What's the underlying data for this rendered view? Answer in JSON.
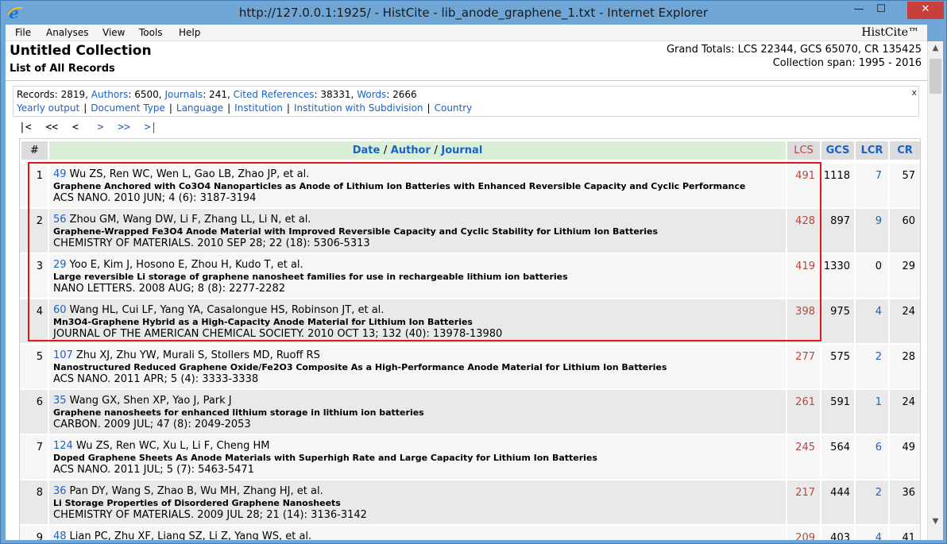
{
  "window": {
    "title": "http://127.0.0.1:1925/ - HistCite - lib_anode_graphene_1.txt - Internet Explorer",
    "minimize_glyph": "—",
    "maximize_glyph": "☐",
    "close_glyph": "✕"
  },
  "menu": {
    "items": [
      "File",
      "Analyses",
      "View",
      "Tools",
      "Help"
    ],
    "brand": "HistCite™"
  },
  "header": {
    "title": "Untitled Collection",
    "subtitle": "List of All Records",
    "grand_totals": "Grand Totals: LCS 22344, GCS 65070, CR 135425",
    "collection_span": "Collection span: 1995 - 2016"
  },
  "summary": {
    "records_label": "Records",
    "records_value": ": 2819, ",
    "authors_label": "Authors",
    "authors_value": ": 6500, ",
    "journals_label": "Journals",
    "journals_value": ": 241, ",
    "cited_label": "Cited References",
    "cited_value": ": 38331, ",
    "words_label": "Words",
    "words_value": ": 2666",
    "close": "x",
    "links": [
      "Yearly output",
      "Document Type",
      "Language",
      "Institution",
      "Institution with Subdivision",
      "Country"
    ],
    "separator": "|"
  },
  "pager": {
    "first": "|<",
    "prev_many": "<<",
    "prev": "<",
    "next": ">",
    "next_many": ">>",
    "last": ">|"
  },
  "table": {
    "col_num": "#",
    "col_date": "Date",
    "col_author": "Author",
    "col_journal": "Journal",
    "col_slash": "/",
    "col_lcs": "LCS",
    "col_gcs": "GCS",
    "col_lcr": "LCR",
    "col_cr": "CR",
    "rows": [
      {
        "num": "1",
        "rid": "49",
        "authors": "Wu ZS, Ren WC, Wen L, Gao LB, Zhao JP, et al.",
        "title": "Graphene Anchored with Co3O4 Nanoparticles as Anode of Lithium Ion Batteries with Enhanced Reversible Capacity and Cyclic Performance",
        "source": "ACS NANO. 2010 JUN; 4 (6): 3187-3194",
        "lcs": "491",
        "gcs": "1118",
        "lcr": "7",
        "cr": "57"
      },
      {
        "num": "2",
        "rid": "56",
        "authors": "Zhou GM, Wang DW, Li F, Zhang LL, Li N, et al.",
        "title": "Graphene-Wrapped Fe3O4 Anode Material with Improved Reversible Capacity and Cyclic Stability for Lithium Ion Batteries",
        "source": "CHEMISTRY OF MATERIALS. 2010 SEP 28; 22 (18): 5306-5313",
        "lcs": "428",
        "gcs": "897",
        "lcr": "9",
        "cr": "60"
      },
      {
        "num": "3",
        "rid": "29",
        "authors": "Yoo E, Kim J, Hosono E, Zhou H, Kudo T, et al.",
        "title": "Large reversible Li storage of graphene nanosheet families for use in rechargeable lithium ion batteries",
        "source": "NANO LETTERS. 2008 AUG; 8 (8): 2277-2282",
        "lcs": "419",
        "gcs": "1330",
        "lcr": "0",
        "cr": "29"
      },
      {
        "num": "4",
        "rid": "60",
        "authors": "Wang HL, Cui LF, Yang YA, Casalongue HS, Robinson JT, et al.",
        "title": "Mn3O4-Graphene Hybrid as a High-Capacity Anode Material for Lithium Ion Batteries",
        "source": "JOURNAL OF THE AMERICAN CHEMICAL SOCIETY. 2010 OCT 13; 132 (40): 13978-13980",
        "lcs": "398",
        "gcs": "975",
        "lcr": "4",
        "cr": "24"
      },
      {
        "num": "5",
        "rid": "107",
        "authors": "Zhu XJ, Zhu YW, Murali S, Stollers MD, Ruoff RS",
        "title": "Nanostructured Reduced Graphene Oxide/Fe2O3 Composite As a High-Performance Anode Material for Lithium Ion Batteries",
        "source": "ACS NANO. 2011 APR; 5 (4): 3333-3338",
        "lcs": "277",
        "gcs": "575",
        "lcr": "2",
        "cr": "28"
      },
      {
        "num": "6",
        "rid": "35",
        "authors": "Wang GX, Shen XP, Yao J, Park J",
        "title": "Graphene nanosheets for enhanced lithium storage in lithium ion batteries",
        "source": "CARBON. 2009 JUL; 47 (8): 2049-2053",
        "lcs": "261",
        "gcs": "591",
        "lcr": "1",
        "cr": "24"
      },
      {
        "num": "7",
        "rid": "124",
        "authors": "Wu ZS, Ren WC, Xu L, Li F, Cheng HM",
        "title": "Doped Graphene Sheets As Anode Materials with Superhigh Rate and Large Capacity for Lithium Ion Batteries",
        "source": "ACS NANO. 2011 JUL; 5 (7): 5463-5471",
        "lcs": "245",
        "gcs": "564",
        "lcr": "6",
        "cr": "49"
      },
      {
        "num": "8",
        "rid": "36",
        "authors": "Pan DY, Wang S, Zhao B, Wu MH, Zhang HJ, et al.",
        "title": "Li Storage Properties of Disordered Graphene Nanosheets",
        "source": "CHEMISTRY OF MATERIALS. 2009 JUL 28; 21 (14): 3136-3142",
        "lcs": "217",
        "gcs": "444",
        "lcr": "2",
        "cr": "36"
      },
      {
        "num": "9",
        "rid": "48",
        "authors": "Lian PC, Zhu XF, Liang SZ, Li Z, Yang WS, et al.",
        "title": "",
        "source": "",
        "lcs": "209",
        "gcs": "403",
        "lcr": "4",
        "cr": "41"
      }
    ]
  },
  "colors": {
    "link": "#1a62c3",
    "lcs": "#b5483c",
    "highlight_box": "#e0161b",
    "titlebar": "#6fa6d6"
  }
}
